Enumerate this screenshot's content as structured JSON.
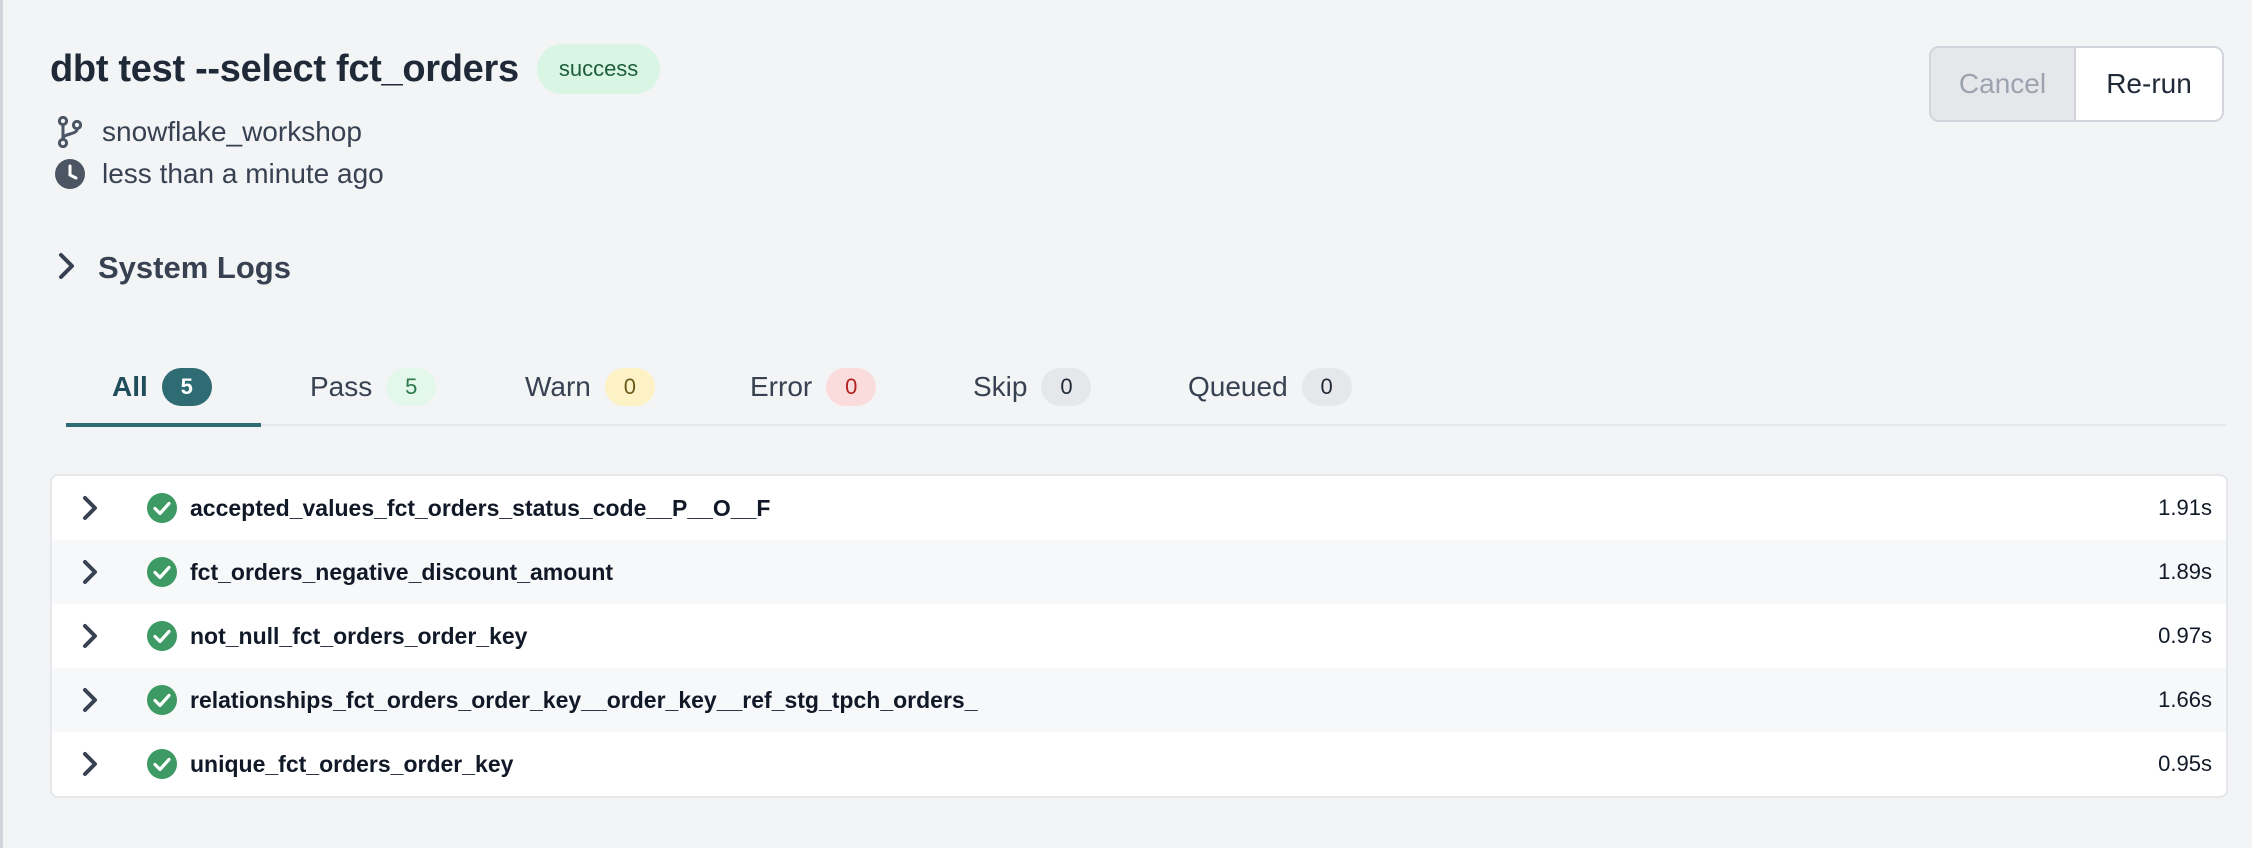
{
  "header": {
    "title": "dbt test --select fct_orders",
    "status_badge": "success",
    "branch": "snowflake_workshop",
    "time_ago": "less than a minute ago"
  },
  "buttons": {
    "cancel_label": "Cancel",
    "rerun_label": "Re-run"
  },
  "system_logs": {
    "label": "System Logs"
  },
  "tabs": [
    {
      "label": "All",
      "count": "5"
    },
    {
      "label": "Pass",
      "count": "5"
    },
    {
      "label": "Warn",
      "count": "0"
    },
    {
      "label": "Error",
      "count": "0"
    },
    {
      "label": "Skip",
      "count": "0"
    },
    {
      "label": "Queued",
      "count": "0"
    }
  ],
  "results": [
    {
      "name": "accepted_values_fct_orders_status_code__P__O__F",
      "duration": "1.91s",
      "status": "pass"
    },
    {
      "name": "fct_orders_negative_discount_amount",
      "duration": "1.89s",
      "status": "pass"
    },
    {
      "name": "not_null_fct_orders_order_key",
      "duration": "0.97s",
      "status": "pass"
    },
    {
      "name": "relationships_fct_orders_order_key__order_key__ref_stg_tpch_orders_",
      "duration": "1.66s",
      "status": "pass"
    },
    {
      "name": "unique_fct_orders_order_key",
      "duration": "0.95s",
      "status": "pass"
    }
  ],
  "colors": {
    "accent": "#2f6b73",
    "success": "#3d9a64",
    "success_bg": "#d9f5e4"
  },
  "icons": {
    "branch": "git-branch-icon",
    "time": "clock-icon",
    "expand": "chevron-right-icon",
    "pass": "check-circle-icon"
  }
}
